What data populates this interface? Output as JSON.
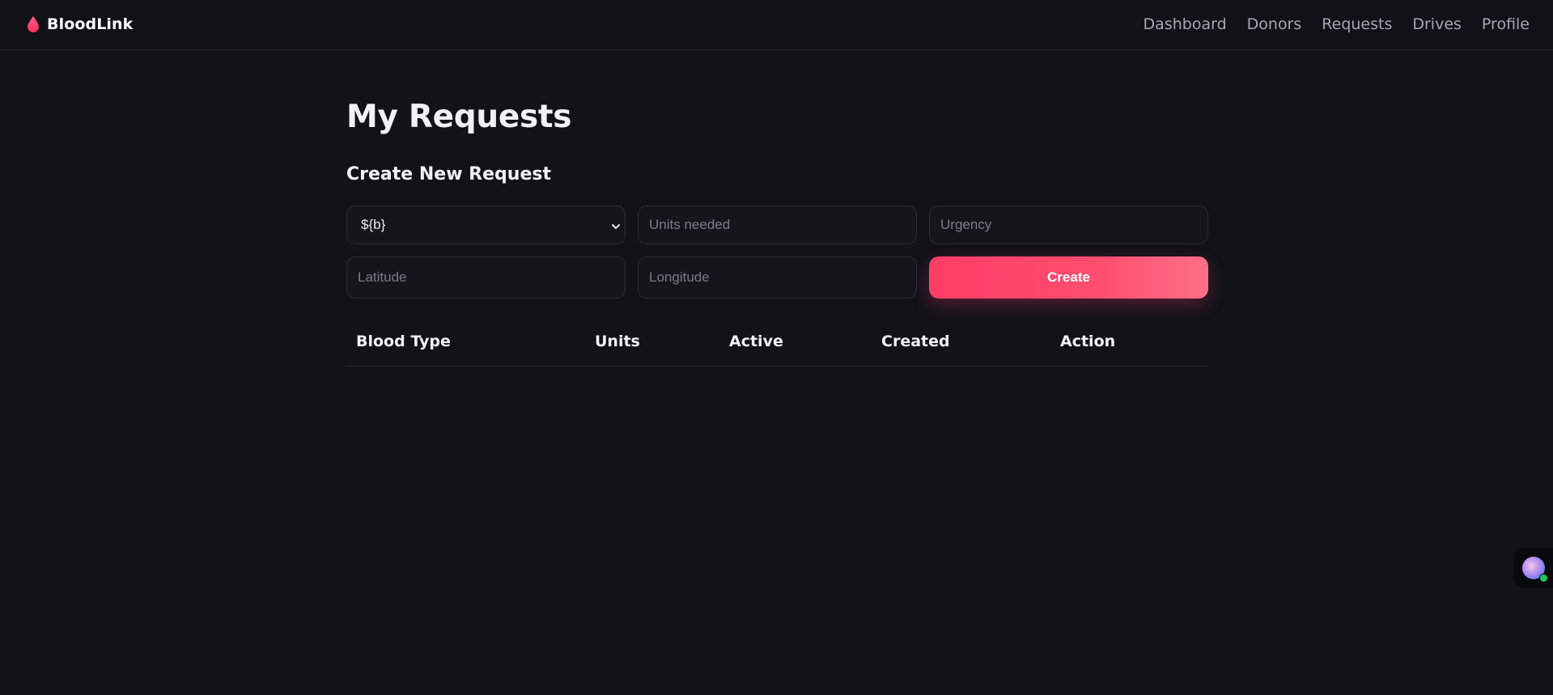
{
  "brand": {
    "name": "BloodLink",
    "icon": "blood-drop-icon",
    "accent": "#ff3d67"
  },
  "nav": {
    "items": [
      {
        "label": "Dashboard"
      },
      {
        "label": "Donors"
      },
      {
        "label": "Requests"
      },
      {
        "label": "Drives"
      },
      {
        "label": "Profile"
      }
    ]
  },
  "page": {
    "title": "My Requests"
  },
  "form": {
    "section_title": "Create New Request",
    "blood_type_value": "${b}",
    "units_placeholder": "Units needed",
    "urgency_placeholder": "Urgency",
    "latitude_placeholder": "Latitude",
    "longitude_placeholder": "Longitude",
    "create_label": "Create"
  },
  "table": {
    "columns": [
      "Blood Type",
      "Units",
      "Active",
      "Created",
      "Action"
    ],
    "rows": []
  },
  "assistant": {
    "icon": "assistant-avatar-icon",
    "status_color": "#22c55e"
  }
}
